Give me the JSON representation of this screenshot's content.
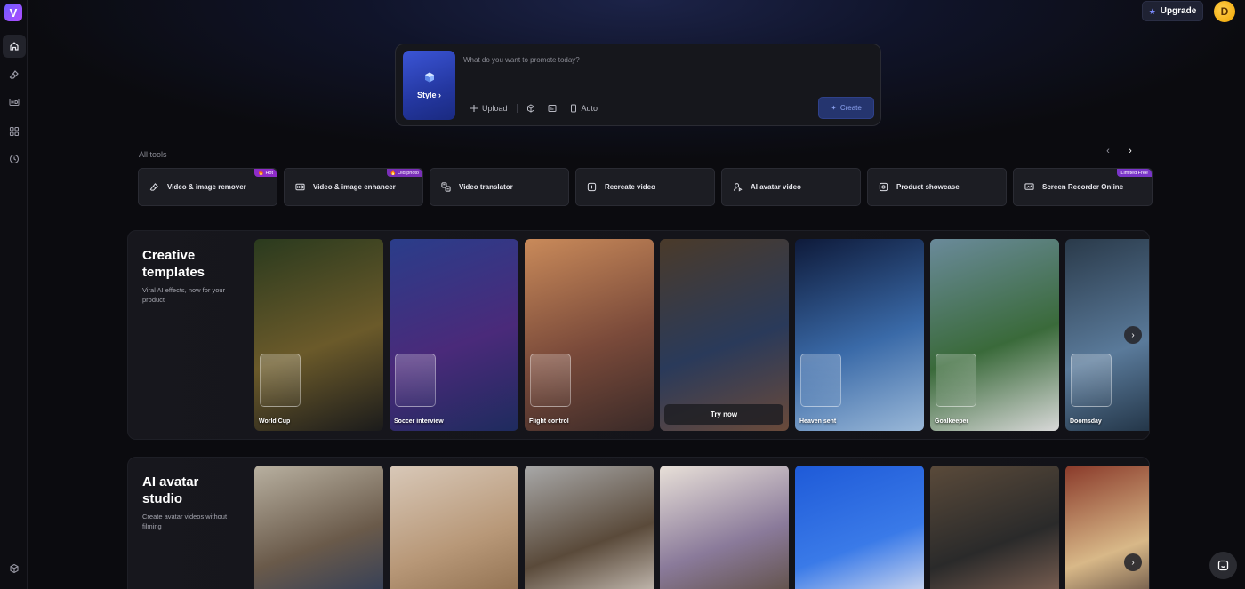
{
  "sidebar": {
    "logo_letter": "V",
    "items": [
      {
        "name": "home-icon"
      },
      {
        "name": "eraser-icon"
      },
      {
        "name": "hd-icon"
      },
      {
        "name": "apps-grid-icon"
      },
      {
        "name": "clock-icon"
      }
    ],
    "bottom_icon": "cube-icon"
  },
  "header": {
    "upgrade_label": "Upgrade",
    "avatar_letter": "D"
  },
  "prompt": {
    "style_label": "Style",
    "placeholder": "What do you want to promote today?",
    "upload_label": "Upload",
    "auto_label": "Auto",
    "create_label": "Create"
  },
  "tools": {
    "section_label": "All tools",
    "items": [
      {
        "label": "Video & image remover",
        "badge": "🔥 Hot",
        "icon": "eraser-icon"
      },
      {
        "label": "Video & image enhancer",
        "badge": "🔥 Old photo",
        "icon": "hd-icon"
      },
      {
        "label": "Video translator",
        "badge": "",
        "icon": "translate-icon"
      },
      {
        "label": "Recreate video",
        "badge": "",
        "icon": "recreate-icon"
      },
      {
        "label": "AI avatar video",
        "badge": "",
        "icon": "avatar-icon"
      },
      {
        "label": "Product showcase",
        "badge": "",
        "icon": "product-icon"
      },
      {
        "label": "Screen Recorder Online",
        "badge": "Limited Free",
        "icon": "screen-record-icon"
      }
    ]
  },
  "creative": {
    "title": "Creative templates",
    "subtitle": "Viral AI effects, now for your product",
    "cards": [
      {
        "label": "World Cup",
        "colors": [
          "#2a3a1e",
          "#6b5a2a",
          "#1b1b1b"
        ]
      },
      {
        "label": "Soccer interview",
        "colors": [
          "#2a3d8a",
          "#4a2a7a",
          "#1e2b5e"
        ]
      },
      {
        "label": "Flight control",
        "colors": [
          "#c98a5a",
          "#7a4a3a",
          "#3a2a28"
        ]
      },
      {
        "label": "Try now",
        "colors": [
          "#4a3a2a",
          "#2a3a5a",
          "#6a4a3a"
        ]
      },
      {
        "label": "Heaven sent",
        "colors": [
          "#0e1a3a",
          "#3a6aa8",
          "#9ab8d8"
        ]
      },
      {
        "label": "Goalkeeper",
        "colors": [
          "#6a8a9a",
          "#3a6a3a",
          "#d8d8d8"
        ]
      },
      {
        "label": "Doomsday",
        "colors": [
          "#2a3a4a",
          "#5a7a9a",
          "#1a2a3a"
        ]
      }
    ]
  },
  "avatar": {
    "title": "AI avatar studio",
    "subtitle": "Create avatar videos without filming",
    "cards": [
      {
        "colors": [
          "#b8b0a0",
          "#6a5a4a",
          "#2a3a5a"
        ]
      },
      {
        "colors": [
          "#d8c8b8",
          "#b89878",
          "#8a6a4a"
        ]
      },
      {
        "colors": [
          "#a8a8a8",
          "#5a4a3a",
          "#d8d0c8"
        ]
      },
      {
        "colors": [
          "#e8e0d8",
          "#8a7a9a",
          "#5a4a3a"
        ]
      },
      {
        "colors": [
          "#1e5ad8",
          "#3a7ae8",
          "#e8e8f0"
        ]
      },
      {
        "colors": [
          "#5a4a3a",
          "#2a2a2a",
          "#8a6a5a"
        ]
      },
      {
        "colors": [
          "#8a3a2a",
          "#d8b888",
          "#3a2a2a"
        ]
      }
    ]
  }
}
